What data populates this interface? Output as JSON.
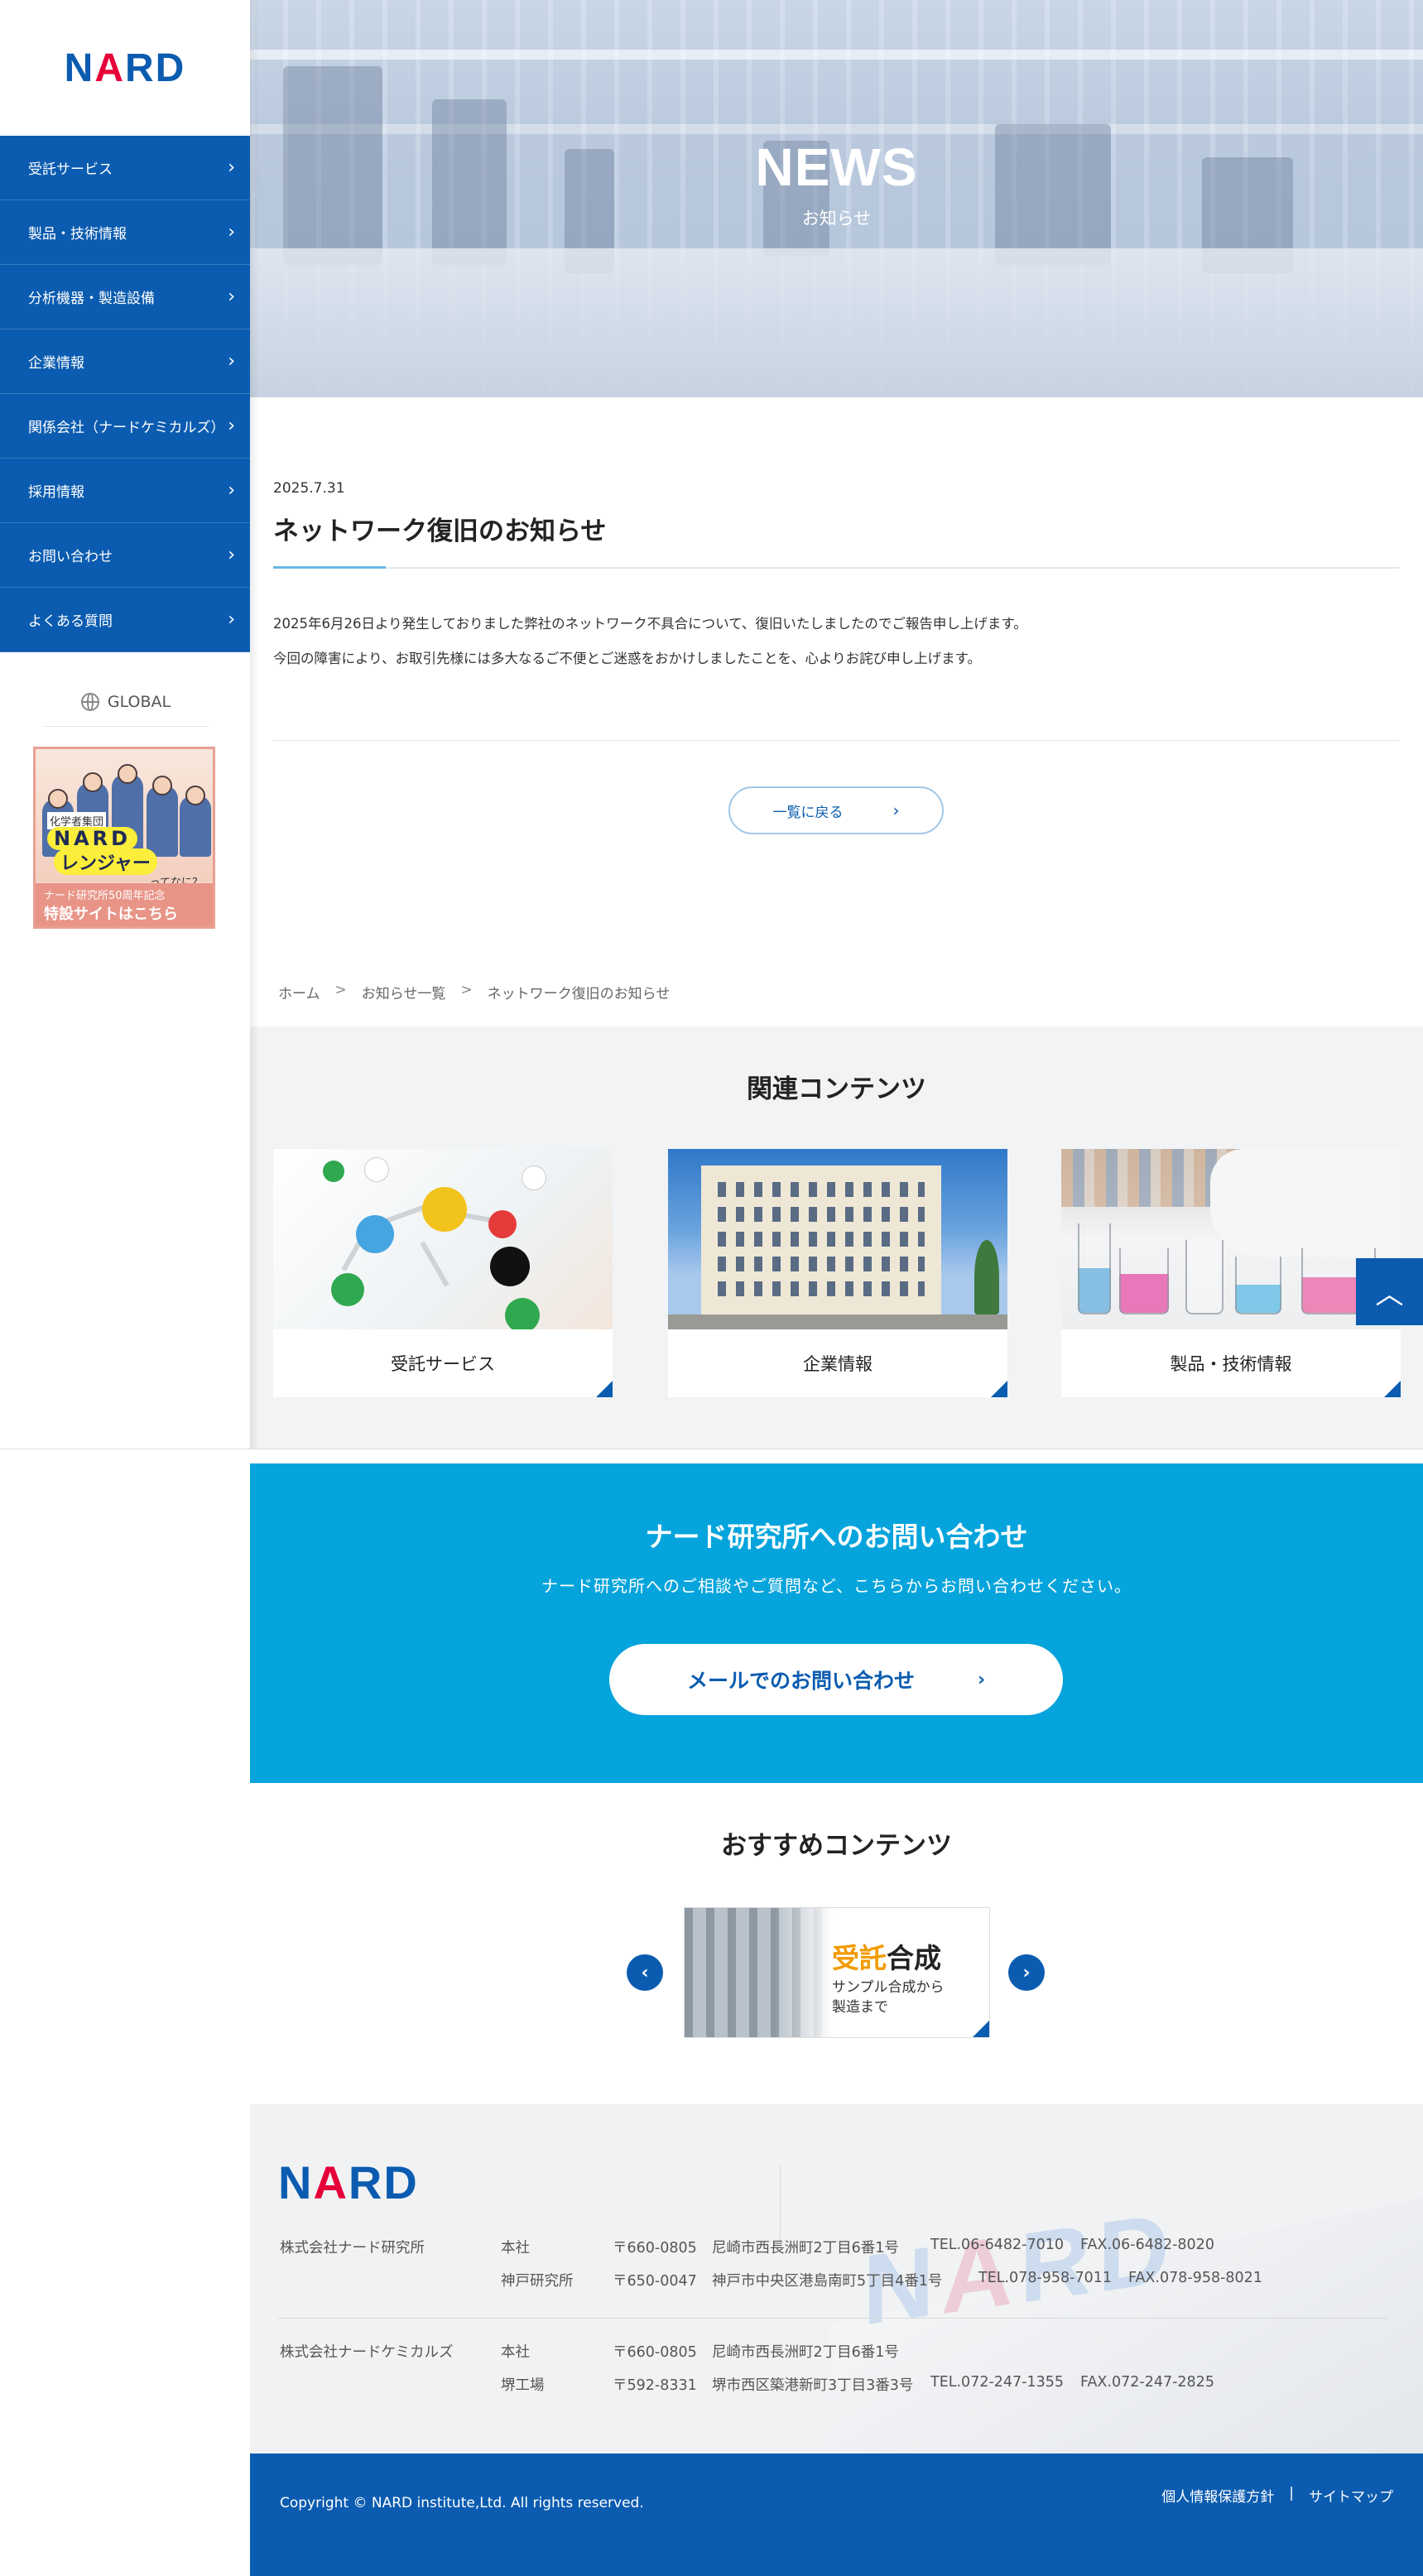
{
  "brand": {
    "logo": "NARD",
    "primary_color": "#0b5cb0",
    "accent_red": "#e60039",
    "contact_color": "#05a4dc"
  },
  "sidebar": {
    "items": [
      {
        "label": "受託サービス"
      },
      {
        "label": "製品・技術情報"
      },
      {
        "label": "分析機器・製造設備"
      },
      {
        "label": "企業情報"
      },
      {
        "label": "関係会社（ナードケミカルズ）"
      },
      {
        "label": "採用情報"
      },
      {
        "label": "お問い合わせ"
      },
      {
        "label": "よくある質問"
      }
    ],
    "global_label": "GLOBAL",
    "banner": {
      "line1": "化学者集団",
      "line2": "NARD",
      "line3": "レンジャー",
      "line4": "ってなに？",
      "line5": "ナード研究所50周年記念",
      "line6": "特設サイトはこちら"
    }
  },
  "hero": {
    "title": "NEWS",
    "subtitle": "お知らせ"
  },
  "article": {
    "date": "2025.7.31",
    "title": "ネットワーク復旧のお知らせ",
    "paragraphs": [
      "2025年6月26日より発生しておりました弊社のネットワーク不具合について、復旧いたしましたのでご報告申し上げます。",
      "今回の障害により、お取引先様には多大なるご不便とご迷惑をおかけしましたことを、心よりお詫び申し上げます。"
    ],
    "back_label": "一覧に戻る"
  },
  "breadcrumb": [
    "ホーム",
    "お知らせ一覧",
    "ネットワーク復旧のお知らせ"
  ],
  "related": {
    "title": "関連コンテンツ",
    "cards": [
      {
        "label": "受託サービス"
      },
      {
        "label": "企業情報"
      },
      {
        "label": "製品・技術情報"
      }
    ]
  },
  "contact": {
    "title": "ナード研究所へのお問い合わせ",
    "subtitle": "ナード研究所へのご相談やご質問など、こちらからお問い合わせください。",
    "button": "メールでのお問い合わせ"
  },
  "recommended": {
    "title": "おすすめコンテンツ",
    "card": {
      "heading_accent": "受託",
      "heading_rest": "合成",
      "desc1": "サンプル合成から",
      "desc2": "製造まで"
    }
  },
  "footer": {
    "company1": {
      "name": "株式会社ナード研究所",
      "sites": [
        {
          "site": "本社",
          "zip": "〒660-0805",
          "addr": "尼崎市西長洲町2丁目6番1号",
          "tel": "TEL.06-6482-7010",
          "fax": "FAX.06-6482-8020"
        },
        {
          "site": "神戸研究所",
          "zip": "〒650-0047",
          "addr": "神戸市中央区港島南町5丁目4番1号",
          "tel": "TEL.078-958-7011",
          "fax": "FAX.078-958-8021"
        }
      ]
    },
    "company2": {
      "name": "株式会社ナードケミカルズ",
      "sites": [
        {
          "site": "本社",
          "zip": "〒660-0805",
          "addr": "尼崎市西長洲町2丁目6番1号",
          "tel": "",
          "fax": ""
        },
        {
          "site": "堺工場",
          "zip": "〒592-8331",
          "addr": "堺市西区築港新町3丁目3番3号",
          "tel": "TEL.072-247-1355",
          "fax": "FAX.072-247-2825"
        }
      ]
    },
    "copyright": "Copyright © NARD institute,Ltd. All rights reserved.",
    "links": {
      "privacy": "個人情報保護方針",
      "sep": "|",
      "sitemap": "サイトマップ"
    }
  },
  "icons": {
    "nav_chevron": "chevron-right-icon",
    "page_top": "chevron-up-icon",
    "global": "globe-icon"
  }
}
